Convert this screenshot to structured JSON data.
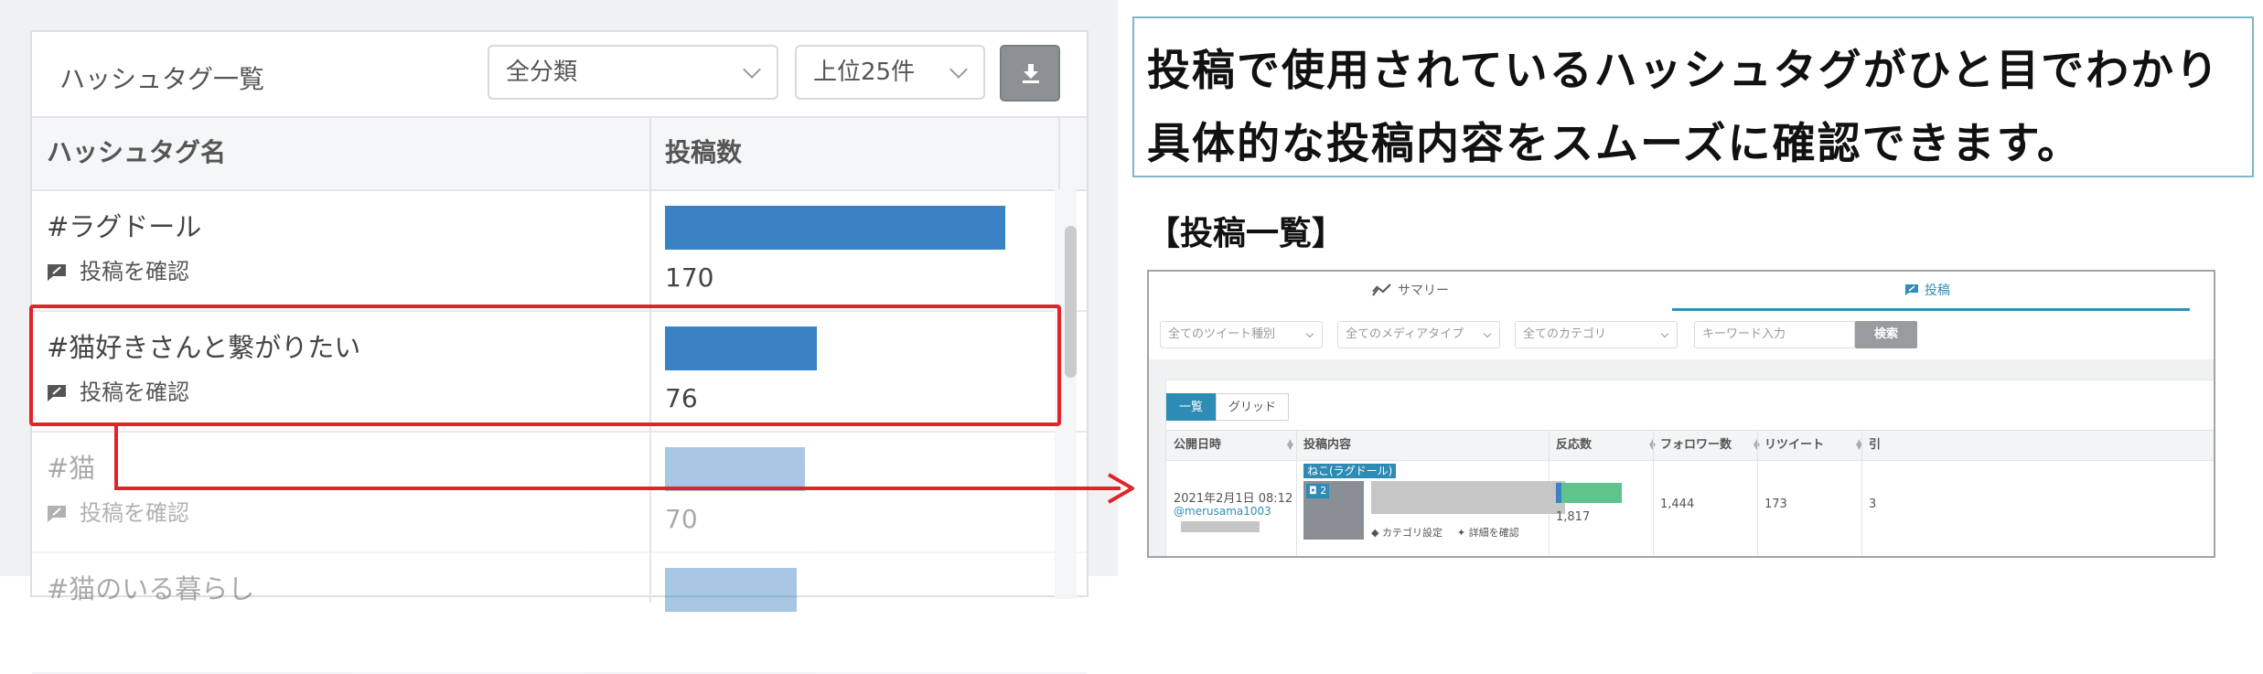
{
  "left_panel": {
    "title": "ハッシュタグ一覧",
    "category_select": "全分類",
    "limit_select": "上位25件",
    "download_icon": "download-icon",
    "columns": [
      "ハッシュタグ名",
      "投稿数"
    ],
    "rows": [
      {
        "tag": "#ラグドール",
        "action": "投稿を確認",
        "count": "170",
        "value": 170,
        "faded": false
      },
      {
        "tag": "#猫好きさんと繋がりたい",
        "action": "投稿を確認",
        "count": "76",
        "value": 76,
        "faded": false
      },
      {
        "tag": "#猫",
        "action": "投稿を確認",
        "count": "70",
        "value": 70,
        "faded": true
      },
      {
        "tag": "#猫のいる暮らし",
        "action": "",
        "count": "",
        "value": 66,
        "faded": true
      }
    ],
    "bar_color": "#3b82c4",
    "highlight_color": "#e0242b"
  },
  "callout": {
    "line1": "投稿で使用されているハッシュタグがひと目でわかり",
    "line2": "具体的な投稿内容をスムーズに確認できます。"
  },
  "section_title": "【投稿一覧】",
  "post_list": {
    "tabs": [
      {
        "label": "サマリー",
        "icon": "trend-icon",
        "active": false
      },
      {
        "label": "投稿",
        "icon": "post-icon",
        "active": true
      }
    ],
    "filters": [
      "全てのツイート種別",
      "全てのメディアタイプ",
      "全てのカテゴリ"
    ],
    "keyword_placeholder": "キーワード入力",
    "search_label": "検索",
    "view_buttons": [
      "一覧",
      "グリッド"
    ],
    "columns": [
      "公開日時",
      "投稿内容",
      "反応数",
      "フォロワー数",
      "リツイート",
      "引"
    ],
    "row": {
      "date": "2021年2月1日 08:12",
      "user": "@merusama1003",
      "category_badge": "ねこ(ラグドール)",
      "photo_count": "2",
      "category_setting": "カテゴリ設定",
      "detail_link": "詳細を確認",
      "reactions": "1,817",
      "followers": "1,444",
      "retweets": "173",
      "quotes": "3"
    },
    "accent_color": "#2f8fb7",
    "reaction_bar_colors": [
      "#3b82c4",
      "#5fc48b"
    ]
  }
}
